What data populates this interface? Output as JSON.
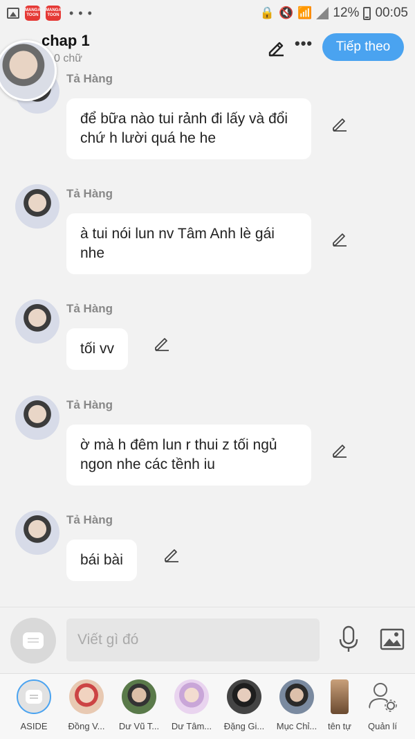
{
  "status_bar": {
    "battery": "12%",
    "time": "00:05",
    "app_icon_label": "MANGA TOON",
    "more": "• • •"
  },
  "header": {
    "title": "chap 1",
    "subtitle": "0 chữ",
    "more": "•••",
    "next_label": "Tiếp theo"
  },
  "messages": [
    {
      "name": "Tả Hàng",
      "text": "để bữa nào tui rảnh đi lấy và đổi chứ h lười quá he he"
    },
    {
      "name": "Tả Hàng",
      "text": "à tui nói lun nv Tâm Anh lè gái nhe"
    },
    {
      "name": "Tả Hàng",
      "text": "tối vv"
    },
    {
      "name": "Tả Hàng",
      "text": "ờ mà h đêm lun r thui z tối ngủ ngon nhe các tềnh iu"
    },
    {
      "name": "Tả Hàng",
      "text": "bái bài"
    }
  ],
  "input": {
    "placeholder": "Viết gì đó"
  },
  "characters": [
    {
      "label": "ASIDE"
    },
    {
      "label": "Đồng V..."
    },
    {
      "label": "Dư Vũ T..."
    },
    {
      "label": "Dư Tâm..."
    },
    {
      "label": "Đặng Gi..."
    },
    {
      "label": "Mục Chỉ..."
    },
    {
      "label": "tên tự"
    },
    {
      "label": "Quản lí"
    }
  ],
  "icons": {
    "edit": "pencil-icon",
    "compose": "compose-icon",
    "mic": "microphone-icon",
    "image": "image-icon",
    "manage": "manage-user-icon"
  },
  "colors": {
    "accent": "#4aa3f0",
    "background": "#f2f2f2",
    "bubble": "#ffffff"
  }
}
